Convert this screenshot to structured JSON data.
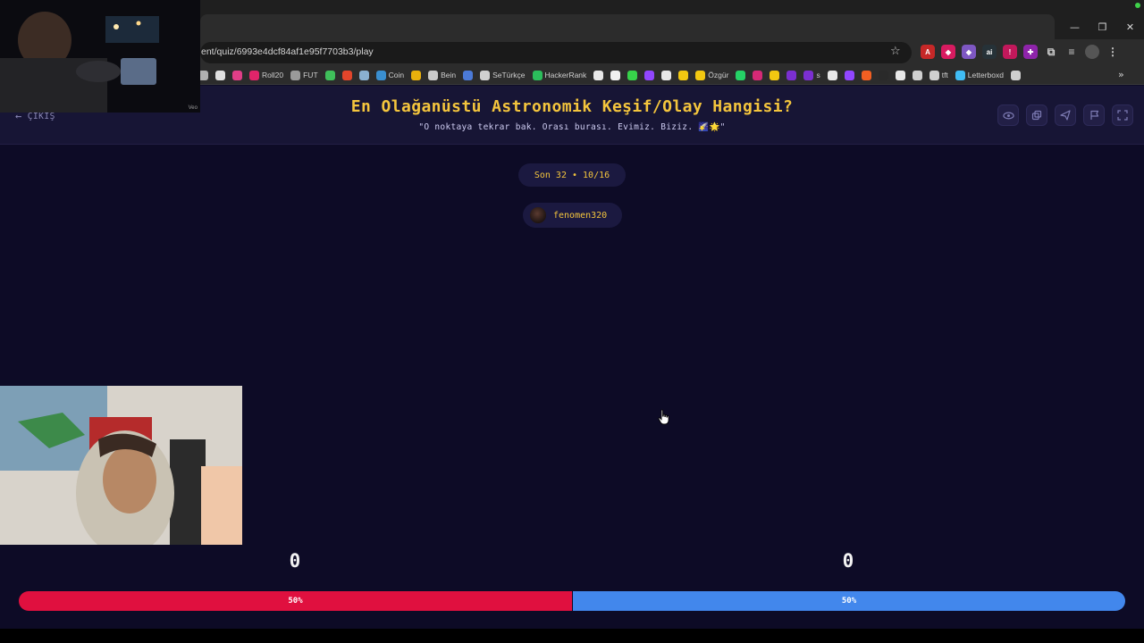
{
  "browser": {
    "url": "ent/quiz/6993e4dcf84af1e95f7703b3/play",
    "window_controls": [
      "—",
      "❐",
      "✕"
    ],
    "bookmarks": [
      {
        "label": "",
        "color": "#b0b0b0"
      },
      {
        "label": "",
        "color": "#e0e0e0"
      },
      {
        "label": "",
        "color": "#e13e87"
      },
      {
        "label": "Roll20",
        "color": "#e2246a"
      },
      {
        "label": "FUT",
        "color": "#9a9a9a"
      },
      {
        "label": "",
        "color": "#3fbf5a"
      },
      {
        "label": "",
        "color": "#e2452b"
      },
      {
        "label": "",
        "color": "#8ab0d0"
      },
      {
        "label": "Coin",
        "color": "#3a8fd0"
      },
      {
        "label": "",
        "color": "#e8b00c"
      },
      {
        "label": "Bein",
        "color": "#c9c9c9"
      },
      {
        "label": "",
        "color": "#4b7ad8"
      },
      {
        "label": "SeTürkçe",
        "color": "#d0d0d0"
      },
      {
        "label": "HackerRank",
        "color": "#2bbd5b"
      },
      {
        "label": "",
        "color": "#e8e8e8"
      },
      {
        "label": "",
        "color": "#f0f0f0"
      },
      {
        "label": "",
        "color": "#37d24a"
      },
      {
        "label": "",
        "color": "#9146ff"
      },
      {
        "label": "",
        "color": "#e8e8e8"
      },
      {
        "label": "",
        "color": "#f2c811"
      },
      {
        "label": "Özgür",
        "color": "#f2c811"
      },
      {
        "label": "",
        "color": "#25d366"
      },
      {
        "label": "",
        "color": "#d62976"
      },
      {
        "label": "",
        "color": "#f2c811"
      },
      {
        "label": "",
        "color": "#7b2fd0"
      },
      {
        "label": "s",
        "color": "#7b2fd0"
      },
      {
        "label": "",
        "color": "#e8e8e8"
      },
      {
        "label": "",
        "color": "#9146ff"
      },
      {
        "label": "",
        "color": "#f25f22"
      },
      {
        "label": "",
        "color": "#2a2a2a"
      },
      {
        "label": "",
        "color": "#e8e8e8"
      },
      {
        "label": "",
        "color": "#d0d0d0"
      },
      {
        "label": "tft",
        "color": "#cfcfcf"
      },
      {
        "label": "Letterboxd",
        "color": "#40bcf4"
      },
      {
        "label": "",
        "color": "#cfcfcf"
      }
    ]
  },
  "header": {
    "exit_label": "ÇIKIŞ",
    "title": "En Olağanüstü Astronomik Keşif/Olay Hangisi?",
    "subtitle": "\"O noktaya tekrar bak. Orası burası. Evimiz. Biziz. 🌠🌟\"",
    "tools": [
      "eye-icon",
      "copy-icon",
      "send-icon",
      "flag-icon",
      "fullscreen-icon"
    ]
  },
  "game": {
    "round": "Son 32 • 10/16",
    "user": "fenomen320",
    "left_score": "0",
    "right_score": "0",
    "left_percent_label": "50%",
    "right_percent_label": "50%",
    "left_share": 0.5,
    "left_color": "#e0103f",
    "right_color": "#4287ec"
  },
  "overlays": {
    "cam_label": "Veo"
  }
}
